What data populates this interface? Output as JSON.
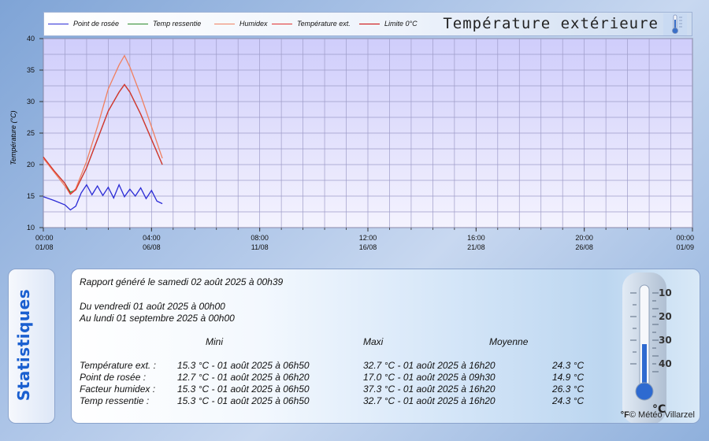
{
  "header": {
    "title": "Température extérieure",
    "legend": [
      {
        "label": "Point de rosée",
        "color": "#2b2bd6"
      },
      {
        "label": "Temp ressentie",
        "color": "#2a8a2a"
      },
      {
        "label": "Humidex",
        "color": "#f08060"
      },
      {
        "label": "Température ext.",
        "color": "#e03030"
      },
      {
        "label": "Limite 0°C",
        "color": "#cc0000"
      }
    ]
  },
  "chart_data": {
    "type": "line",
    "ylabel": "Température (°C)",
    "ylim": [
      10,
      40
    ],
    "yticks": [
      10,
      15,
      20,
      25,
      30,
      35,
      40
    ],
    "xticks": [
      {
        "time": "00:00",
        "date": "01/08"
      },
      {
        "time": "04:00",
        "date": "06/08"
      },
      {
        "time": "08:00",
        "date": "11/08"
      },
      {
        "time": "12:00",
        "date": "16/08"
      },
      {
        "time": "16:00",
        "date": "21/08"
      },
      {
        "time": "20:00",
        "date": "26/08"
      },
      {
        "time": "00:00",
        "date": "01/09"
      }
    ],
    "series": [
      {
        "name": "Point de rosée",
        "color": "#2b2bd6",
        "x": [
          0.0,
          0.1,
          0.2,
          0.25,
          0.3,
          0.35,
          0.4,
          0.45,
          0.5,
          0.55,
          0.6,
          0.65,
          0.7,
          0.75,
          0.8,
          0.85,
          0.9,
          0.95,
          1.0,
          1.05,
          1.1
        ],
        "y": [
          14.9,
          14.3,
          13.6,
          12.8,
          13.4,
          15.5,
          16.8,
          15.2,
          16.6,
          15.1,
          16.4,
          14.7,
          16.8,
          14.9,
          16.1,
          15.0,
          16.3,
          14.6,
          15.9,
          14.2,
          13.8
        ]
      },
      {
        "name": "Temp ressentie",
        "color": "#2a8a2a",
        "x": [
          0.0,
          0.1,
          0.2,
          0.25,
          0.3,
          0.4,
          0.5,
          0.6,
          0.7,
          0.75,
          0.8,
          0.9,
          1.0,
          1.1
        ],
        "y": [
          21.2,
          19.0,
          17.0,
          15.6,
          16.0,
          19.5,
          24.0,
          28.5,
          31.5,
          32.7,
          31.5,
          28.0,
          24.0,
          20.0
        ]
      },
      {
        "name": "Humidex",
        "color": "#f08060",
        "x": [
          0.0,
          0.1,
          0.2,
          0.25,
          0.3,
          0.4,
          0.5,
          0.6,
          0.7,
          0.75,
          0.8,
          0.9,
          1.0,
          1.1
        ],
        "y": [
          21.0,
          18.8,
          16.6,
          15.3,
          16.2,
          20.5,
          26.0,
          32.0,
          35.8,
          37.3,
          35.5,
          31.0,
          26.0,
          21.0
        ]
      },
      {
        "name": "Température ext.",
        "color": "#e03030",
        "x": [
          0.0,
          0.1,
          0.2,
          0.25,
          0.3,
          0.4,
          0.5,
          0.6,
          0.7,
          0.75,
          0.8,
          0.9,
          1.0,
          1.1
        ],
        "y": [
          21.2,
          19.0,
          17.0,
          15.3,
          16.0,
          19.5,
          24.0,
          28.5,
          31.5,
          32.7,
          31.5,
          28.0,
          24.0,
          20.0
        ]
      }
    ]
  },
  "stats": {
    "tab_label": "Statistiques",
    "generated": "Rapport généré le samedi 02 août 2025 à 00h39",
    "from": "Du vendredi 01 août 2025 à 00h00",
    "to": "Au lundi 01 septembre 2025 à 00h00",
    "col_mini": "Mini",
    "col_maxi": "Maxi",
    "col_moyenne": "Moyenne",
    "rows": [
      {
        "label": "Température ext. :",
        "mini": "15.3 °C - 01 août 2025 à 06h50",
        "maxi": "32.7 °C - 01 août 2025 à 16h20",
        "moy": "24.3 °C"
      },
      {
        "label": "Point de rosée :",
        "mini": "12.7 °C - 01 août 2025 à 06h20",
        "maxi": "17.0 °C - 01 août 2025 à 09h30",
        "moy": "14.9 °C"
      },
      {
        "label": "Facteur humidex :",
        "mini": "15.3 °C - 01 août 2025 à 06h50",
        "maxi": "37.3 °C - 01 août 2025 à 16h20",
        "moy": "26.3 °C"
      },
      {
        "label": "Temp ressentie :",
        "mini": "15.3 °C - 01 août 2025 à 06h50",
        "maxi": "32.7 °C - 01 août 2025 à 16h20",
        "moy": "24.3 °C"
      }
    ],
    "credit": "© Météo Villarzel",
    "therm_scale": [
      "40",
      "30",
      "20",
      "10"
    ],
    "therm_unit_c": "°C",
    "therm_unit_f": "°F"
  }
}
